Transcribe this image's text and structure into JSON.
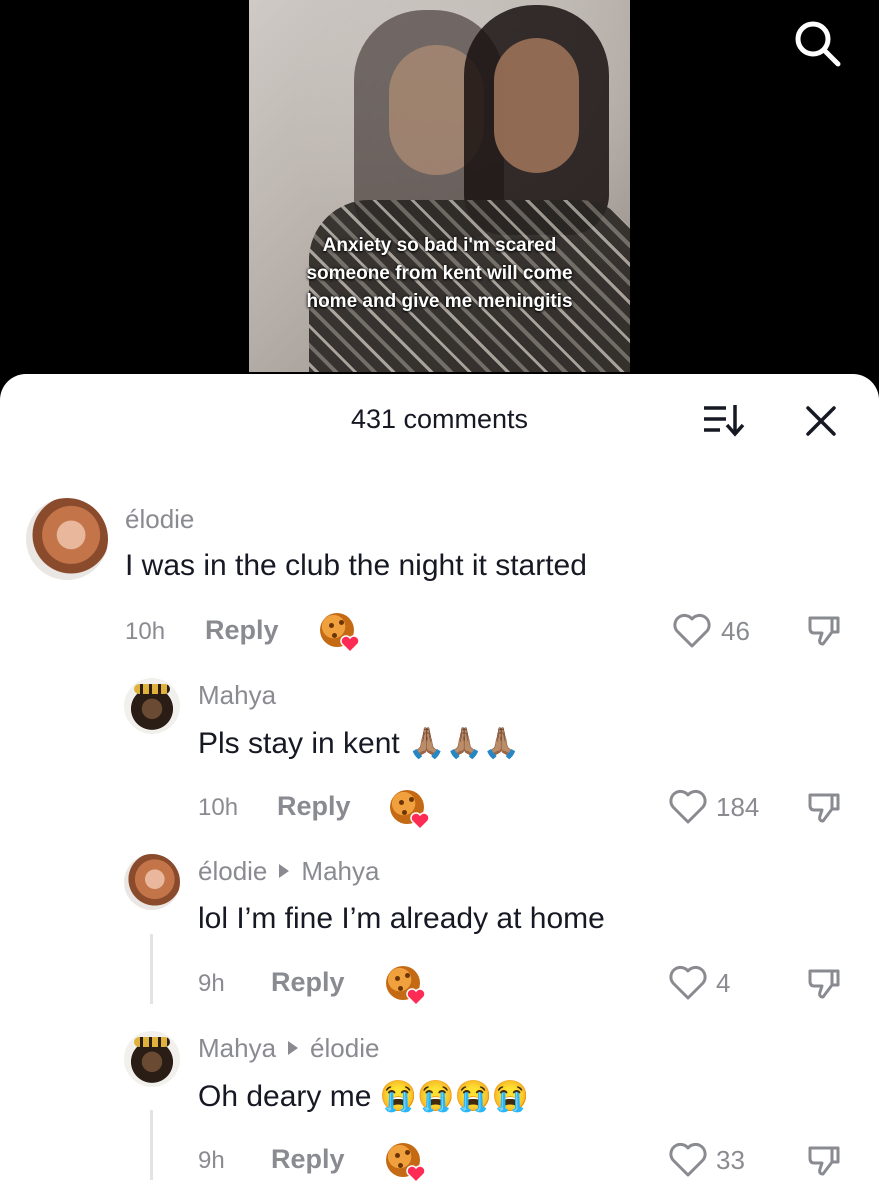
{
  "video": {
    "caption": "Anxiety so bad i'm scared someone from kent will come home and give me meningitis"
  },
  "header": {
    "comments_count": "431 comments"
  },
  "comments": [
    {
      "user": "élodie",
      "text": "I was in the club the night it started",
      "emoji": "",
      "time": "10h",
      "reply_label": "Reply",
      "likes": "46"
    },
    {
      "user": "Mahya",
      "text": "Pls stay in kent",
      "emoji": "🙏🏽🙏🏽🙏🏽",
      "time": "10h",
      "reply_label": "Reply",
      "likes": "184"
    },
    {
      "user": "élodie",
      "reply_to": "Mahya",
      "text": "lol I’m fine I’m already at home",
      "emoji": "",
      "time": "9h",
      "reply_label": "Reply",
      "likes": "4"
    },
    {
      "user": "Mahya",
      "reply_to": "élodie",
      "text": "Oh deary me",
      "emoji": "😭😭😭😭",
      "time": "9h",
      "reply_label": "Reply",
      "likes": "33"
    }
  ],
  "icons": {
    "search": "search-icon",
    "sort": "sort-icon",
    "close": "close-icon",
    "like": "heart-outline-icon",
    "dislike": "thumbs-down-icon",
    "creator_liked": "creator-liked-icon"
  },
  "colors": {
    "text_primary": "#161823",
    "text_secondary": "#8a8b91",
    "heart_badge": "#fe2c55"
  }
}
